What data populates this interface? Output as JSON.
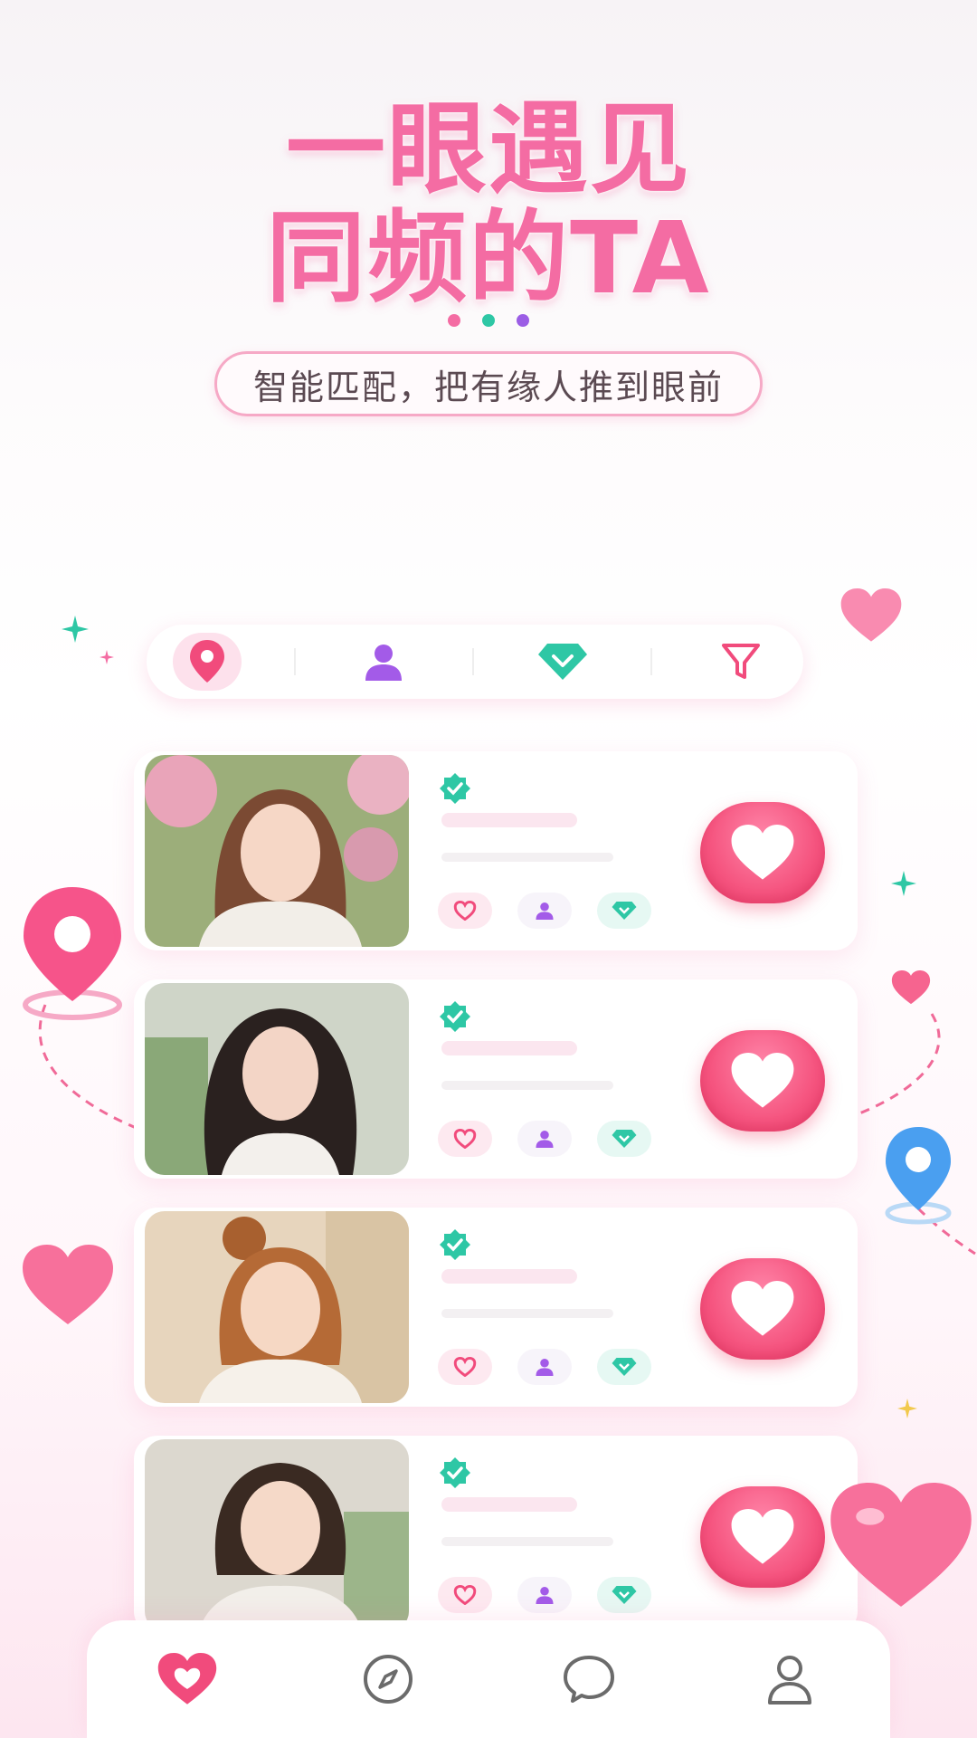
{
  "hero": {
    "title_line1": "一眼遇见",
    "title_line2": "同频的TA",
    "dots": [
      "#f46ca3",
      "#2ec7a5",
      "#9b5de5"
    ],
    "subtitle": "智能匹配，把有缘人推到眼前"
  },
  "filters": {
    "items": [
      {
        "icon": "location-pin-icon",
        "color": "#f14b7c",
        "active": true
      },
      {
        "icon": "person-icon",
        "color": "#a35be8",
        "active": false
      },
      {
        "icon": "diamond-icon",
        "color": "#2ec7a5",
        "active": false
      },
      {
        "icon": "filter-funnel-icon",
        "color": "#f14b7c",
        "active": false
      }
    ]
  },
  "cards": [
    {
      "photo": "portrait-woman-1",
      "verified": true
    },
    {
      "photo": "portrait-woman-2",
      "verified": true
    },
    {
      "photo": "portrait-woman-3",
      "verified": true
    },
    {
      "photo": "portrait-woman-4",
      "verified": true
    }
  ],
  "tabbar": {
    "items": [
      {
        "icon": "heart-icon",
        "active": true
      },
      {
        "icon": "compass-icon",
        "active": false
      },
      {
        "icon": "chat-bubble-icon",
        "active": false
      },
      {
        "icon": "profile-icon",
        "active": false
      }
    ]
  },
  "colors": {
    "accent_pink": "#f46ca3",
    "like_red": "#f5547f",
    "teal": "#2ec7a5",
    "purple": "#9b5de5"
  }
}
